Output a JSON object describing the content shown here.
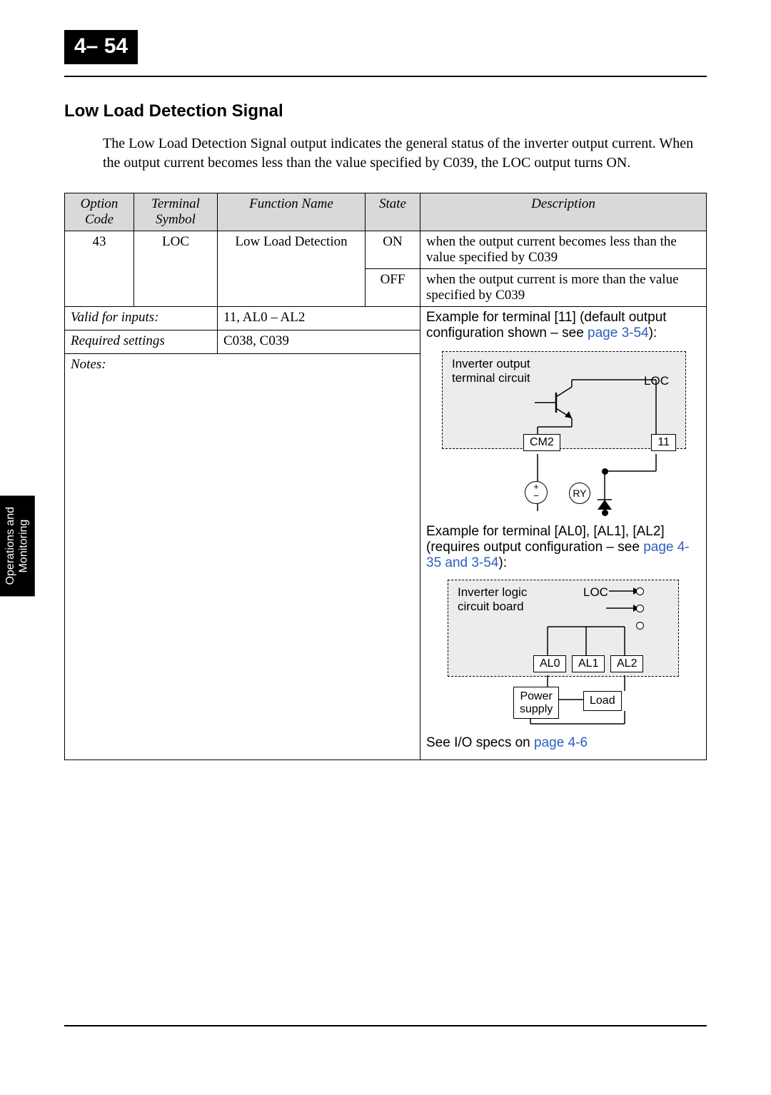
{
  "page_number": "4– 54",
  "side_tab": "Operations and\nMonitoring",
  "section_title": "Low Load Detection Signal",
  "intro": "The Low Load Detection Signal output indicates the general status of the inverter output current. When the output current becomes less than the value specified by C039, the LOC output turns ON.",
  "headers": {
    "option_code": "Option Code",
    "terminal_symbol": "Terminal Symbol",
    "function_name": "Function Name",
    "state": "State",
    "description": "Description"
  },
  "row": {
    "option_code": "43",
    "terminal_symbol": "LOC",
    "function_name": "Low Load Detection",
    "state_on": "ON",
    "desc_on": "when the output current becomes less than the value specified by C039",
    "state_off": "OFF",
    "desc_off": "when the output current is more than the value specified by C039"
  },
  "valid_for_inputs_label": "Valid for inputs:",
  "valid_for_inputs": "11, AL0 – AL2",
  "required_settings_label": "Required settings",
  "required_settings": "C038, C039",
  "notes_label": "Notes:",
  "example1_pre": "Example for terminal [11] (default output configuration shown – see ",
  "example1_link": "page 3-54",
  "example1_post": "):",
  "diag1": {
    "caption": "Inverter output\nterminal circuit",
    "loc": "LOC",
    "cm2": "CM2",
    "t11": "11",
    "ry": "RY"
  },
  "example2_pre": "Example for terminal [AL0], [AL1], [AL2] (requires output configuration – see ",
  "example2_link": "page 4-35 and 3-54",
  "example2_post": "):",
  "diag2": {
    "caption": "Inverter logic\ncircuit board",
    "loc": "LOC",
    "al0": "AL0",
    "al1": "AL1",
    "al2": "AL2",
    "power": "Power\nsupply",
    "load": "Load"
  },
  "io_specs_pre": "See I/O specs on ",
  "io_specs_link": "page 4-6"
}
